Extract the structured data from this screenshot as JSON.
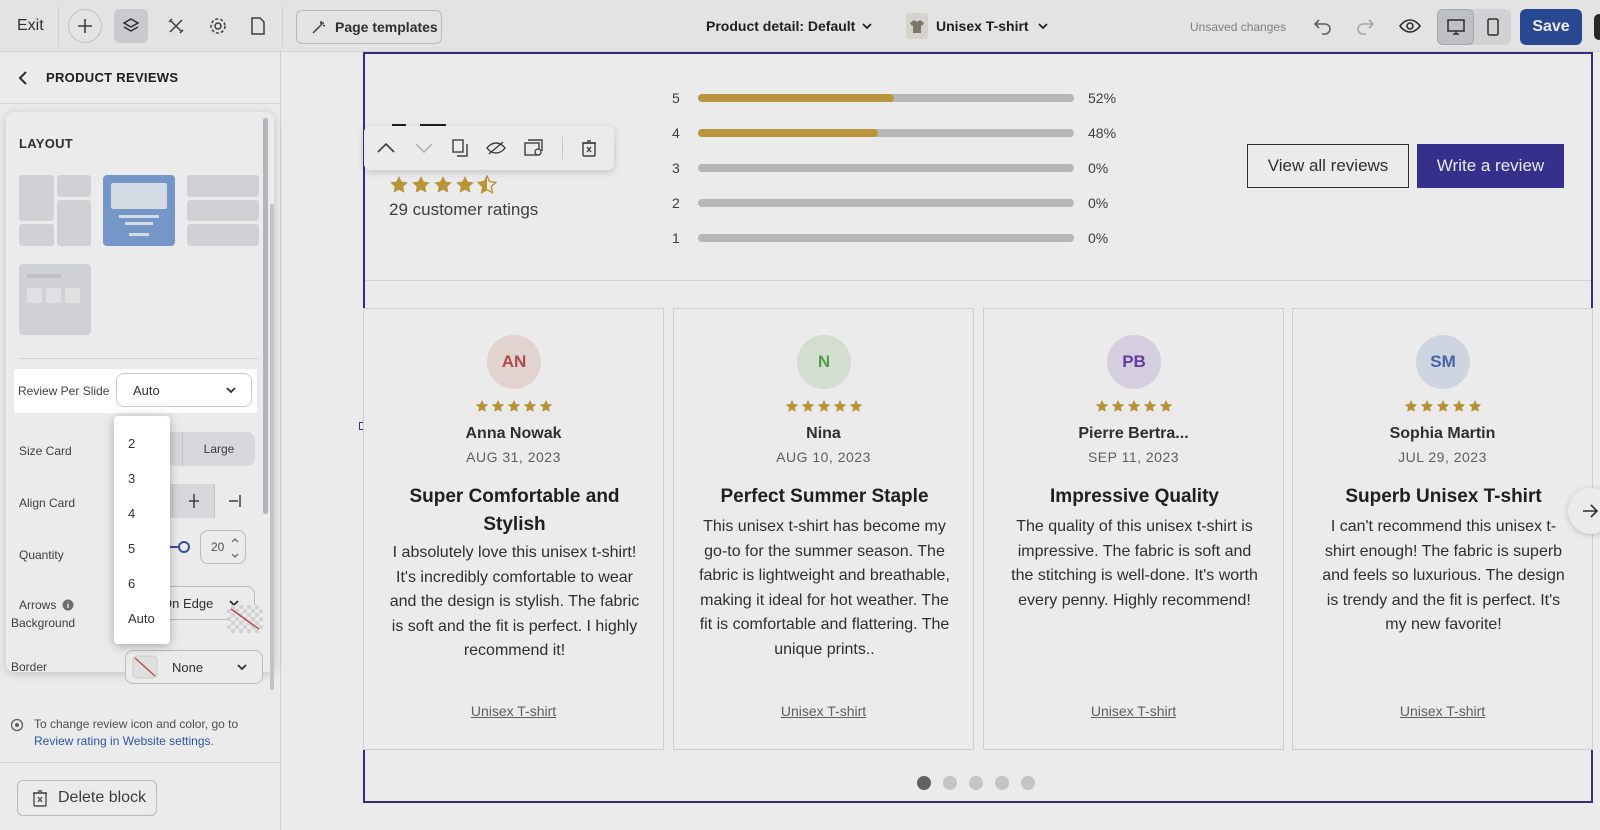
{
  "topbar": {
    "exit": "Exit",
    "page_templates": "Page templates",
    "page_selector": "Product detail: Default",
    "product_selector": "Unisex T-shirt",
    "unsaved": "Unsaved changes",
    "save": "Save"
  },
  "panel": {
    "title": "PRODUCT REVIEWS",
    "layout_title": "LAYOUT",
    "review_per_slide_label": "Review Per Slide",
    "review_per_slide_value": "Auto",
    "size_card_label": "Size Card",
    "size_card_large": "Large",
    "align_card_label": "Align Card",
    "quantity_label": "Quantity",
    "quantity_value": "20",
    "arrows_label": "Arrows",
    "arrows_value": "On Edge",
    "background_label": "Background",
    "border_label": "Border",
    "border_value": "None",
    "note_text": "To change review icon and color, go to",
    "note_link": "Review rating in Website settings.",
    "delete_block": "Delete block",
    "dropdown_options": [
      "2",
      "3",
      "4",
      "5",
      "6",
      "Auto"
    ]
  },
  "summary": {
    "ratings_count": "29 customer ratings",
    "stars": 4.5,
    "distribution": [
      {
        "star": "5",
        "pct": "52%",
        "value": 0.52
      },
      {
        "star": "4",
        "pct": "48%",
        "value": 0.48
      },
      {
        "star": "3",
        "pct": "0%",
        "value": 0
      },
      {
        "star": "2",
        "pct": "0%",
        "value": 0
      },
      {
        "star": "1",
        "pct": "0%",
        "value": 0
      }
    ],
    "view_all": "View all reviews",
    "write": "Write a review"
  },
  "reviews": [
    {
      "initials": "AN",
      "avatar_bg": "#f6e5e3",
      "avatar_fg": "#c0504d",
      "name": "Anna Nowak",
      "date": "AUG 31, 2023",
      "title": "Super Comfortable and Stylish",
      "body": "I absolutely love this unisex t-shirt! It's incredibly comfortable to wear and the design is stylish. The fabric is soft and the fit is perfect. I highly recommend it!",
      "product": "Unisex T-shirt"
    },
    {
      "initials": "N",
      "avatar_bg": "#e5f1e3",
      "avatar_fg": "#5aaa54",
      "name": "Nina",
      "date": "AUG 10, 2023",
      "title": "Perfect Summer Staple",
      "body": "This unisex t-shirt has become my go-to for the summer season. The fabric is lightweight and breathable, making it ideal for hot weather. The fit is comfortable and flattering. The unique prints..",
      "product": "Unisex T-shirt"
    },
    {
      "initials": "PB",
      "avatar_bg": "#e7e0f2",
      "avatar_fg": "#7040b0",
      "name": "Pierre Bertra...",
      "date": "SEP 11, 2023",
      "title": "Impressive Quality",
      "body": "The quality of this unisex t-shirt is impressive. The fabric is soft and the stitching is well-done. It's worth every penny. Highly recommend!",
      "product": "Unisex T-shirt"
    },
    {
      "initials": "SM",
      "avatar_bg": "#e0e8f5",
      "avatar_fg": "#4a6cb8",
      "name": "Sophia Martin",
      "date": "JUL 29, 2023",
      "title": "Superb Unisex T-shirt",
      "body": "I can't recommend this unisex t-shirt enough! The fabric is superb and feels so luxurious. The design is trendy and the fit is perfect. It's my new favorite!",
      "product": "Unisex T-shirt"
    }
  ],
  "colors": {
    "star": "#c9a13c",
    "brand": "#3a3598",
    "save": "#2c4f9e"
  }
}
